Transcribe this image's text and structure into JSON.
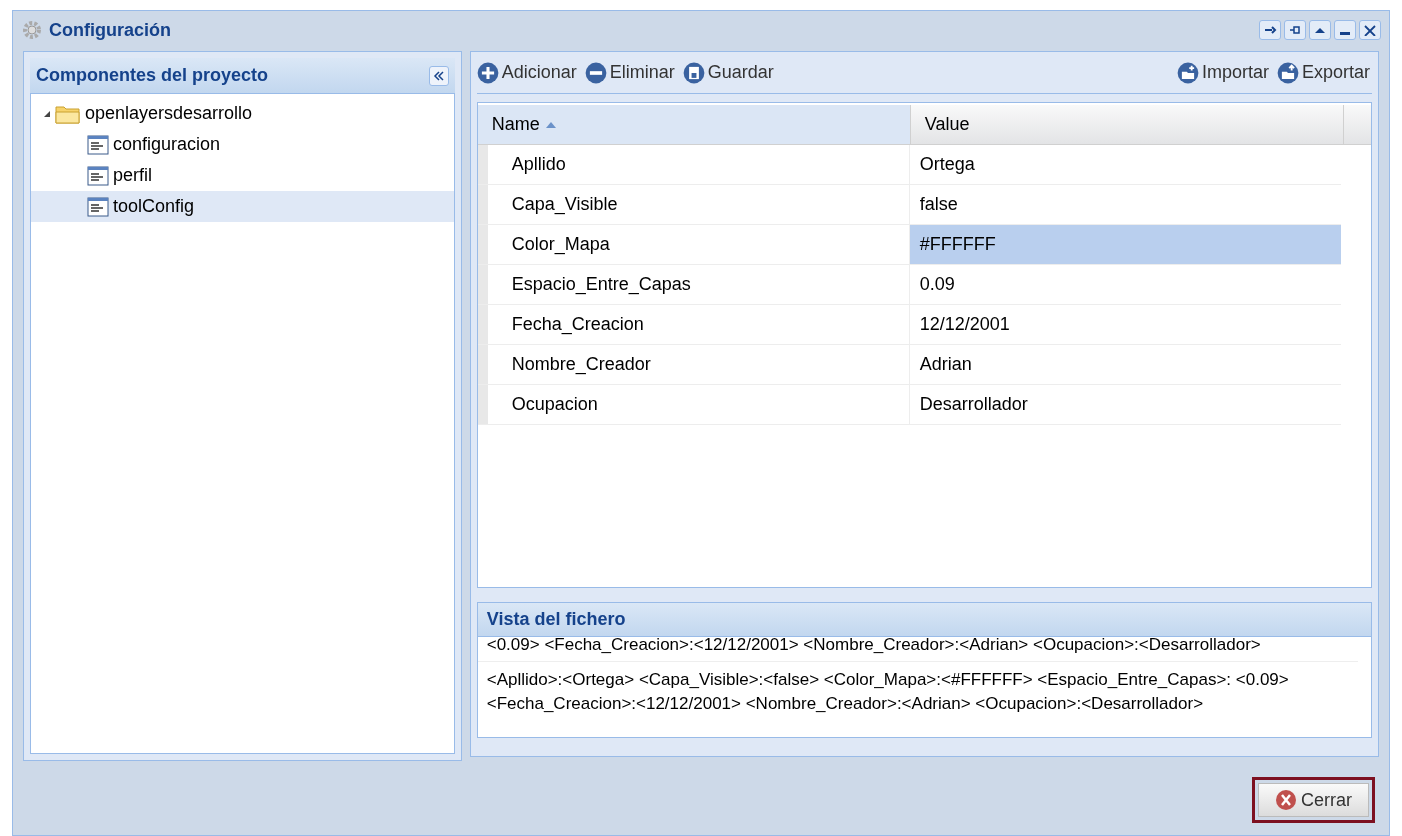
{
  "window": {
    "title": "Configuración",
    "tools": [
      {
        "kind": "pin-right"
      },
      {
        "kind": "pin"
      },
      {
        "kind": "collapse"
      },
      {
        "kind": "minimize"
      },
      {
        "kind": "close"
      }
    ]
  },
  "sidebar": {
    "title": "Componentes del proyecto",
    "tree": [
      {
        "label": "openlayersdesarrollo",
        "kind": "folder",
        "expanded": true,
        "selected": false,
        "children": [
          {
            "label": "configuracion",
            "kind": "file",
            "selected": false
          },
          {
            "label": "perfil",
            "kind": "file",
            "selected": false
          },
          {
            "label": "toolConfig",
            "kind": "file",
            "selected": true
          }
        ]
      }
    ]
  },
  "toolbar": {
    "left": [
      {
        "label": "Adicionar",
        "kind": "add"
      },
      {
        "label": "Eliminar",
        "kind": "remove"
      },
      {
        "label": "Guardar",
        "kind": "save"
      }
    ],
    "right": [
      {
        "label": "Importar",
        "kind": "import"
      },
      {
        "label": "Exportar",
        "kind": "export"
      }
    ]
  },
  "table": {
    "columns": [
      {
        "label": "Name",
        "sorted": true
      },
      {
        "label": "Value",
        "sorted": false
      }
    ],
    "rows": [
      {
        "name": "Apllido",
        "value": "Ortega",
        "selected": false
      },
      {
        "name": "Capa_Visible",
        "value": "false",
        "selected": false
      },
      {
        "name": "Color_Mapa",
        "value": "#FFFFFF",
        "selected": true
      },
      {
        "name": "Espacio_Entre_Capas",
        "value": "0.09",
        "selected": false
      },
      {
        "name": "Fecha_Creacion",
        "value": "12/12/2001",
        "selected": false
      },
      {
        "name": "Nombre_Creador",
        "value": "Adrian",
        "selected": false
      },
      {
        "name": "Ocupacion",
        "value": "Desarrollador",
        "selected": false
      }
    ]
  },
  "file_view": {
    "title": "Vista del fichero",
    "entries": [
      "<0.09> <Fecha_Creacion>:<12/12/2001> <Nombre_Creador>:<Adrian> <Ocupacion>:<Desarrollador>",
      "<Apllido>:<Ortega> <Capa_Visible>:<false> <Color_Mapa>:<#FFFFFF> <Espacio_Entre_Capas>: <0.09> <Fecha_Creacion>:<12/12/2001> <Nombre_Creador>:<Adrian> <Ocupacion>:<Desarrollador>"
    ]
  },
  "footer": {
    "button": "Cerrar"
  }
}
